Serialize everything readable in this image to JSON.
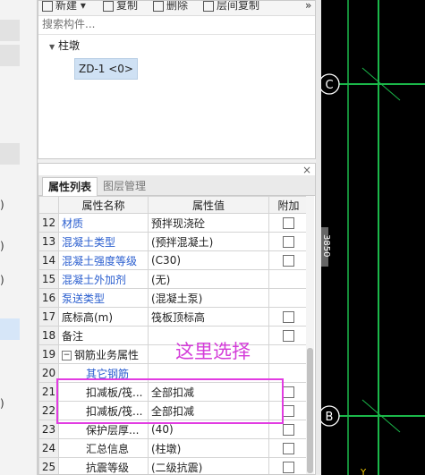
{
  "left_strip": {
    "chars": [
      ")",
      ")",
      ")",
      ")"
    ]
  },
  "toolbar": {
    "new": "新建",
    "copy": "复制",
    "delete": "删除",
    "layer_copy": "层间复制",
    "more": "»"
  },
  "search": {
    "placeholder": "搜索构件..."
  },
  "tree": {
    "group": "柱墩",
    "item": "ZD-1 <0>"
  },
  "tabs": {
    "list": "属性列表",
    "layers": "图层管理",
    "close": "×"
  },
  "table": {
    "headers": [
      "属性名称",
      "属性值",
      "附加"
    ],
    "rows": [
      {
        "num": "12",
        "name": "材质",
        "value": "预拌现浇砼",
        "blue": true,
        "check": true
      },
      {
        "num": "13",
        "name": "混凝土类型",
        "value": "(预拌混凝土)",
        "blue": true,
        "check": true
      },
      {
        "num": "14",
        "name": "混凝土强度等级",
        "value": "(C30)",
        "blue": true,
        "check": true
      },
      {
        "num": "15",
        "name": "混凝土外加剂",
        "value": "(无)",
        "blue": true,
        "check": false
      },
      {
        "num": "16",
        "name": "泵送类型",
        "value": "(混凝土泵)",
        "blue": true,
        "check": false
      },
      {
        "num": "17",
        "name": "底标高(m)",
        "value": "筏板顶标高",
        "blue": false,
        "check": true
      },
      {
        "num": "18",
        "name": "备注",
        "value": "",
        "blue": false,
        "check": true
      },
      {
        "num": "19",
        "name": "钢筋业务属性",
        "value": "",
        "blue": false,
        "check": false,
        "expander": "−"
      },
      {
        "num": "20",
        "name": "其它钢筋",
        "value": "",
        "blue": true,
        "check": false,
        "indent": true
      },
      {
        "num": "21",
        "name": "扣减板/筏...",
        "value": "全部扣减",
        "blue": false,
        "check": true,
        "indent": true
      },
      {
        "num": "22",
        "name": "扣减板/筏...",
        "value": "全部扣减",
        "blue": false,
        "check": true,
        "indent": true
      },
      {
        "num": "23",
        "name": "保护层厚...",
        "value": "(40)",
        "blue": false,
        "check": true,
        "indent": true
      },
      {
        "num": "24",
        "name": "汇总信息",
        "value": "(柱墩)",
        "blue": false,
        "check": true,
        "indent": true
      },
      {
        "num": "25",
        "name": "抗震等级",
        "value": "(二级抗震)",
        "blue": false,
        "check": true,
        "indent": true
      }
    ]
  },
  "annotation": {
    "text": "这里选择",
    "color": "#e23ce2"
  },
  "canvas": {
    "label_c": "C",
    "label_b": "B",
    "dim": "3850",
    "axis_label": "Y",
    "line_color": "#1bb84a"
  }
}
